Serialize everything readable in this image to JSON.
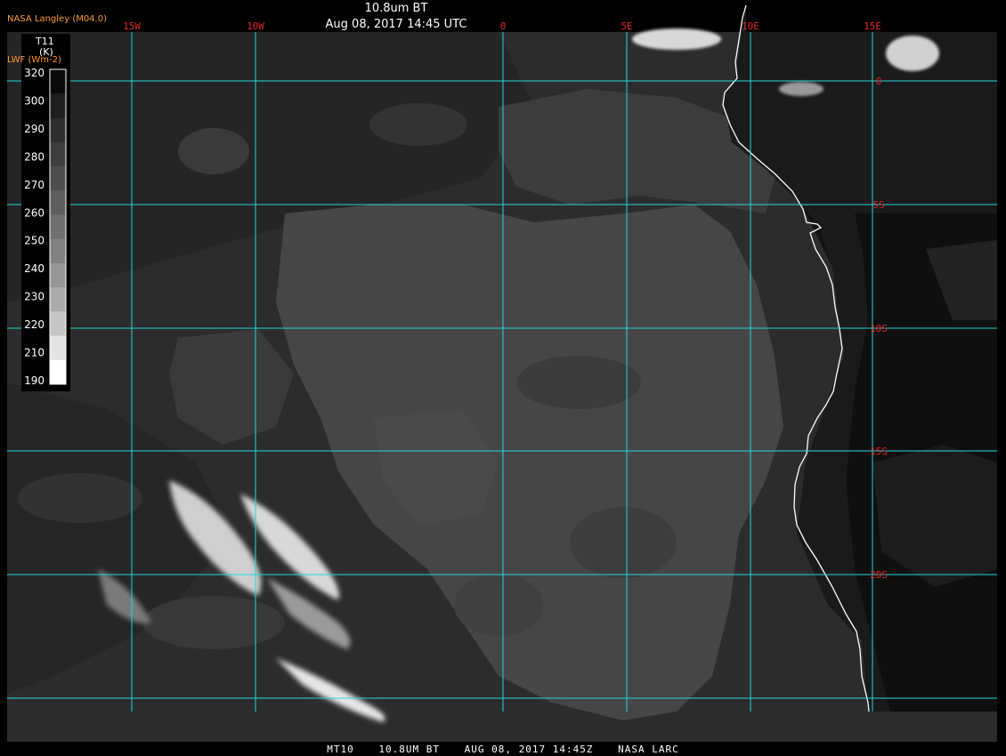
{
  "header": {
    "title": "10.8um BT",
    "datetime": "Aug 08, 2017 14:45 UTC",
    "credit": "NASA Langley (M04.0)"
  },
  "legend": {
    "title_line1": "T11",
    "title_line2": "(K)",
    "overlay_label": "LWF (Wm-2)",
    "ticks": [
      "320",
      "300",
      "290",
      "280",
      "270",
      "260",
      "250",
      "240",
      "230",
      "220",
      "210",
      "190"
    ],
    "shades": [
      "#0a0a0a",
      "#1e1e1e",
      "#2e2e2e",
      "#3e3e3e",
      "#4e4e4e",
      "#5e5e5e",
      "#707070",
      "#828282",
      "#969696",
      "#ababab",
      "#c6c6c6",
      "#e4e4e4",
      "#ffffff"
    ]
  },
  "grid": {
    "longitudes": [
      "15W",
      "10W",
      "0",
      "5E",
      "10E",
      "15E"
    ],
    "latitudes": [
      "0",
      "5S",
      "10S",
      "15S",
      "20S"
    ],
    "line_color": "#22d8d8",
    "label_color": "#e02828"
  },
  "colors": {
    "land": "#5a5a5a",
    "ocean_base": "#2c2c2c",
    "cold_sea": "#121212",
    "coastline": "#ffffff"
  },
  "footer": {
    "satellite": "MT10",
    "channel": "10.8UM BT",
    "date": "AUG 08, 2017 14:45Z",
    "source": "NASA LARC"
  }
}
